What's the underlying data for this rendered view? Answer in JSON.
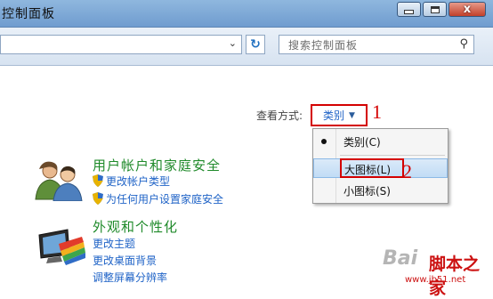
{
  "window": {
    "title": "控制面板",
    "close_glyph": "x"
  },
  "address_bar": {
    "address": "",
    "dropdown_glyph": "⌄",
    "refresh_glyph": "↻",
    "search_placeholder": "搜索控制面板",
    "search_glyph": "⚲"
  },
  "view": {
    "label": "查看方式:",
    "selected": "类别",
    "arrow": "▼",
    "annotation_1": "1",
    "annotation_2": "2",
    "menu": [
      "类别(C)",
      "大图标(L)",
      "小图标(S)"
    ]
  },
  "categories": [
    {
      "title": "用户帐户和家庭安全",
      "links": [
        "更改帐户类型",
        "为任何用户设置家庭安全"
      ]
    },
    {
      "title": "外观和个性化",
      "links": [
        "更改主题",
        "更改桌面背景",
        "调整屏幕分辨率"
      ]
    }
  ],
  "watermark": {
    "brand": "Bai",
    "site": "脚本之家",
    "url": "www.jb51.net"
  },
  "colors": {
    "accent_red": "#d40000",
    "link_blue": "#1f63c7",
    "category_green": "#1f8a2a"
  }
}
